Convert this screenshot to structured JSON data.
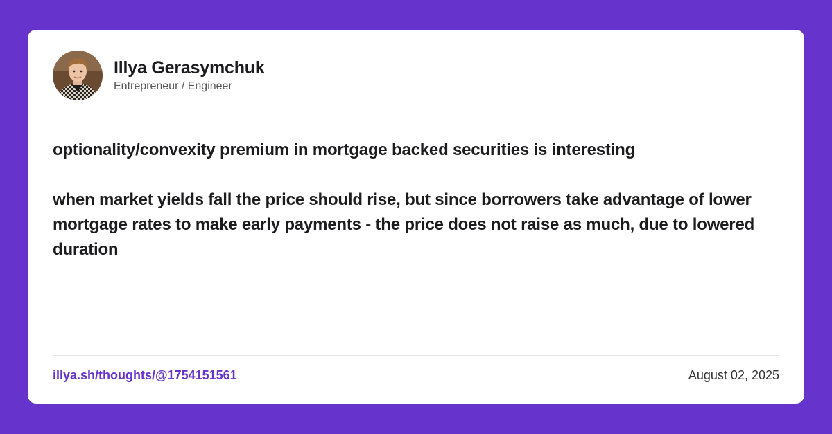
{
  "colors": {
    "background": "#6633cc",
    "card": "#ffffff",
    "link": "#6633cc",
    "text": "#1c1c1e"
  },
  "author": {
    "name": "Illya Gerasymchuk",
    "role": "Entrepreneur / Engineer",
    "avatar_icon": "profile-photo"
  },
  "post": {
    "paragraphs": [
      "optionality/convexity premium in mortgage backed securities is interesting",
      "when market yields fall the price should rise, but since borrowers take advantage of lower mortgage rates to make early payments - the price does not raise as much, due to lowered duration"
    ]
  },
  "footer": {
    "link": "illya.sh/thoughts/@1754151561",
    "date": "August 02, 2025"
  }
}
